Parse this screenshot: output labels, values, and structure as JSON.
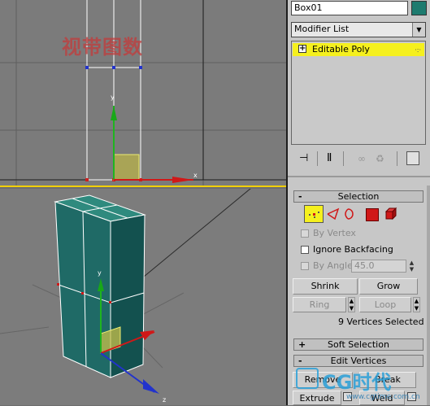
{
  "watermark_top": "视带图数",
  "panel": {
    "object_name": "Box01",
    "modifier_list_label": "Modifier List",
    "stack_item": "Editable Poly",
    "stack_expand": "+",
    "colors": {
      "accent": "#f5f01e",
      "panel_bg": "#c7c7c7",
      "subobj_vertex_active": "#f5f01e"
    }
  },
  "selection": {
    "title": "Selection",
    "sign": "-",
    "by_vertex": "By Vertex",
    "ignore_backfacing": "Ignore Backfacing",
    "by_angle": "By Angle:",
    "angle_value": "45.0",
    "shrink": "Shrink",
    "grow": "Grow",
    "ring": "Ring",
    "loop": "Loop",
    "status": "9 Vertices Selected"
  },
  "soft_selection": {
    "title": "Soft Selection",
    "sign": "+"
  },
  "edit_vertices": {
    "title": "Edit Vertices",
    "sign": "-",
    "remove": "Remove",
    "break": "Break",
    "extrude": "Extrude",
    "weld": "Weld"
  },
  "watermark": {
    "logo": "CG时代",
    "url": "www.cgtime.com.cn"
  },
  "icons": [
    "pin-icon",
    "show-end-result-icon",
    "make-unique-icon",
    "remove-modifier-icon",
    "configure-modifier-sets-icon",
    "vertex-icon",
    "edge-icon",
    "border-icon",
    "polygon-icon",
    "element-icon"
  ]
}
